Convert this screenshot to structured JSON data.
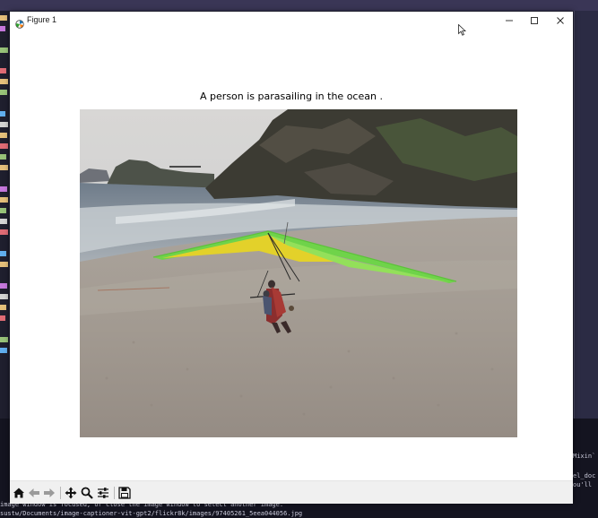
{
  "window": {
    "title": "Figure 1"
  },
  "figure": {
    "caption": "A person is parasailing in the ocean ."
  },
  "toolbar": {
    "items": [
      {
        "name": "home",
        "icon": "home-icon"
      },
      {
        "name": "back",
        "icon": "arrow-left-icon"
      },
      {
        "name": "forward",
        "icon": "arrow-right-icon"
      },
      {
        "name": "pan",
        "icon": "move-icon"
      },
      {
        "name": "zoom",
        "icon": "magnifier-icon"
      },
      {
        "name": "configure",
        "icon": "sliders-icon"
      },
      {
        "name": "save",
        "icon": "floppy-disk-icon"
      }
    ]
  },
  "terminal": {
    "line1": "image window is focused, or close the image window to select another image.",
    "line2": "sustw/Documents/image-captioner-vit-gpt2/flickr8k/images/97405261_5eea044056.jpg",
    "right1": "Mixin`",
    "right2": "el_doc",
    "right3": "ou'll"
  },
  "colors": {
    "accent_code": "#e06c75",
    "window_bg": "#ffffff",
    "toolbar_bg": "#f0f0f0"
  }
}
